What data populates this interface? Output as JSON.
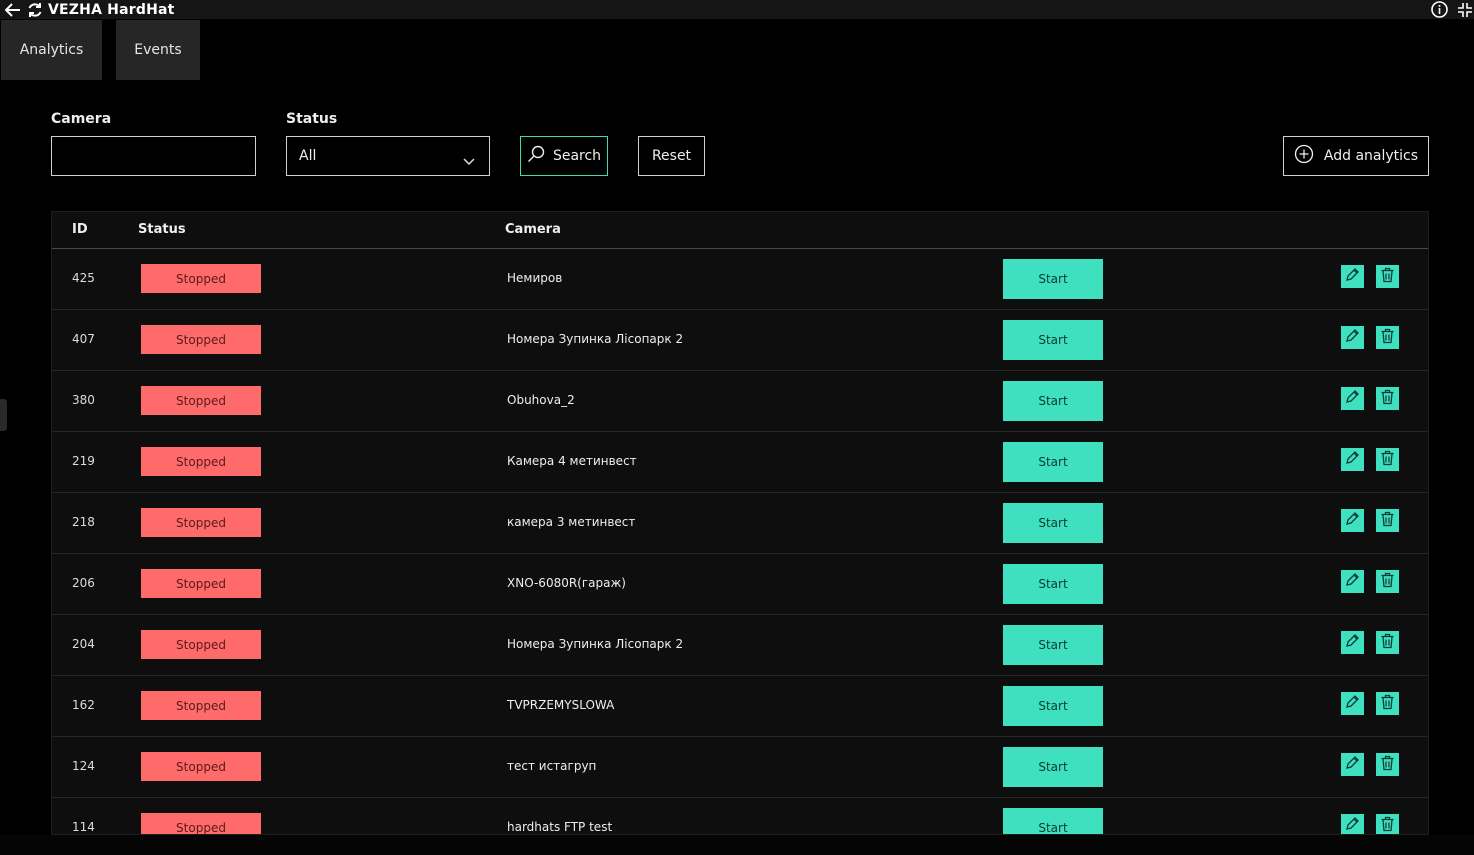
{
  "app": {
    "title": "VEZHA HardHat"
  },
  "tabs": [
    {
      "label": "Analytics"
    },
    {
      "label": "Events"
    }
  ],
  "filters": {
    "camera_label": "Camera",
    "camera_value": "",
    "status_label": "Status",
    "status_value": "All",
    "search_label": "Search",
    "reset_label": "Reset",
    "add_label": "Add analytics"
  },
  "table": {
    "headers": {
      "id": "ID",
      "status": "Status",
      "camera": "Camera"
    },
    "start_label": "Start",
    "rows": [
      {
        "id": "425",
        "status": "Stopped",
        "camera": "Немиров"
      },
      {
        "id": "407",
        "status": "Stopped",
        "camera": "Номера Зупинка Лісопарк 2"
      },
      {
        "id": "380",
        "status": "Stopped",
        "camera": "Obuhova_2"
      },
      {
        "id": "219",
        "status": "Stopped",
        "camera": "Камера 4 метинвест"
      },
      {
        "id": "218",
        "status": "Stopped",
        "camera": "камера 3 метинвест"
      },
      {
        "id": "206",
        "status": "Stopped",
        "camera": "XNO-6080R(гараж)"
      },
      {
        "id": "204",
        "status": "Stopped",
        "camera": "Номера Зупинка Лісопарк 2"
      },
      {
        "id": "162",
        "status": "Stopped",
        "camera": "TVPRZEMYSLOWA"
      },
      {
        "id": "124",
        "status": "Stopped",
        "camera": "тест истагруп"
      },
      {
        "id": "114",
        "status": "Stopped",
        "camera": "hardhats FTP test"
      }
    ]
  },
  "colors": {
    "accent": "#3fe0c0",
    "stopped": "#ff6b6b",
    "background": "#000000"
  },
  "icons": [
    "back-arrow-icon",
    "refresh-icon",
    "info-icon",
    "collapse-icon",
    "search-icon",
    "chevron-down-icon",
    "plus-circle-icon",
    "pencil-icon",
    "trash-icon"
  ]
}
